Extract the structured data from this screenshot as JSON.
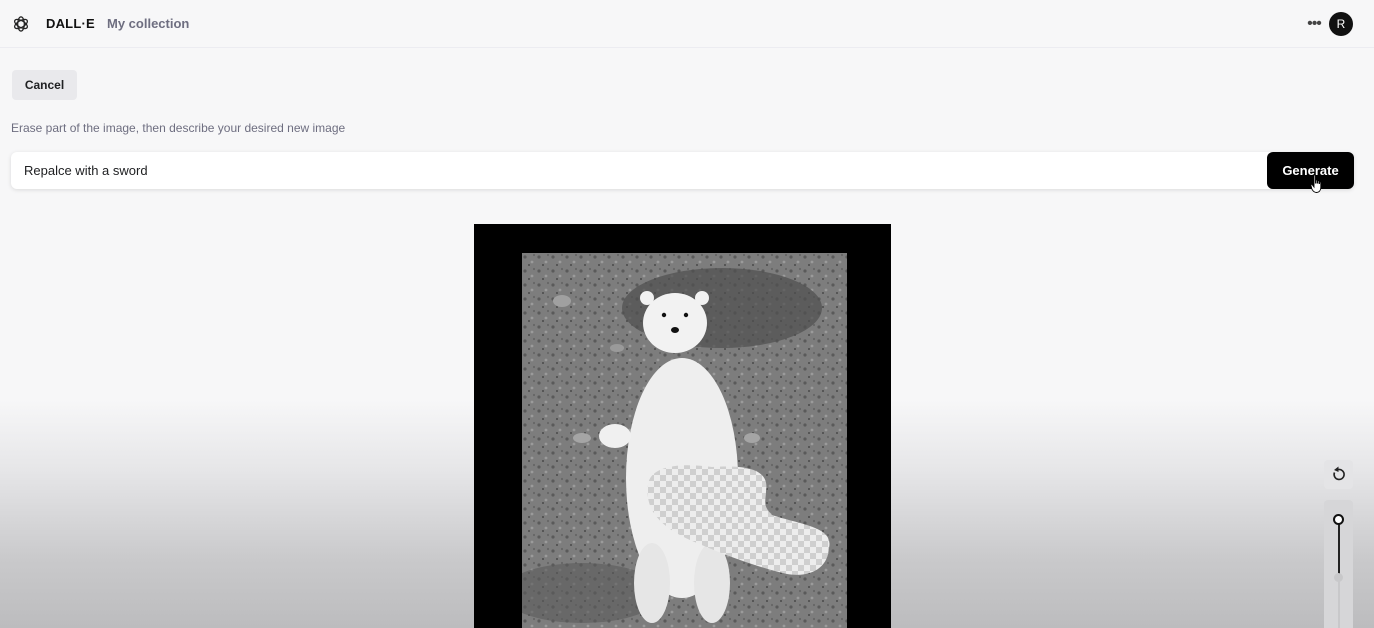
{
  "header": {
    "brand": "DALL·E",
    "collection_link": "My collection",
    "more_icon": "more-horizontal-icon",
    "avatar_initial": "R"
  },
  "editor": {
    "cancel_label": "Cancel",
    "instructions": "Erase part of the image, then describe your desired new image",
    "prompt_value": "Repalce with a sword",
    "generate_label": "Generate"
  },
  "tools": {
    "undo_icon": "rotate-ccw-icon",
    "brush_size_slider_icon": "slider-icon"
  },
  "colors": {
    "accent": "#000000",
    "page_bg": "#f7f7f8",
    "muted_text": "#6e6e80"
  }
}
